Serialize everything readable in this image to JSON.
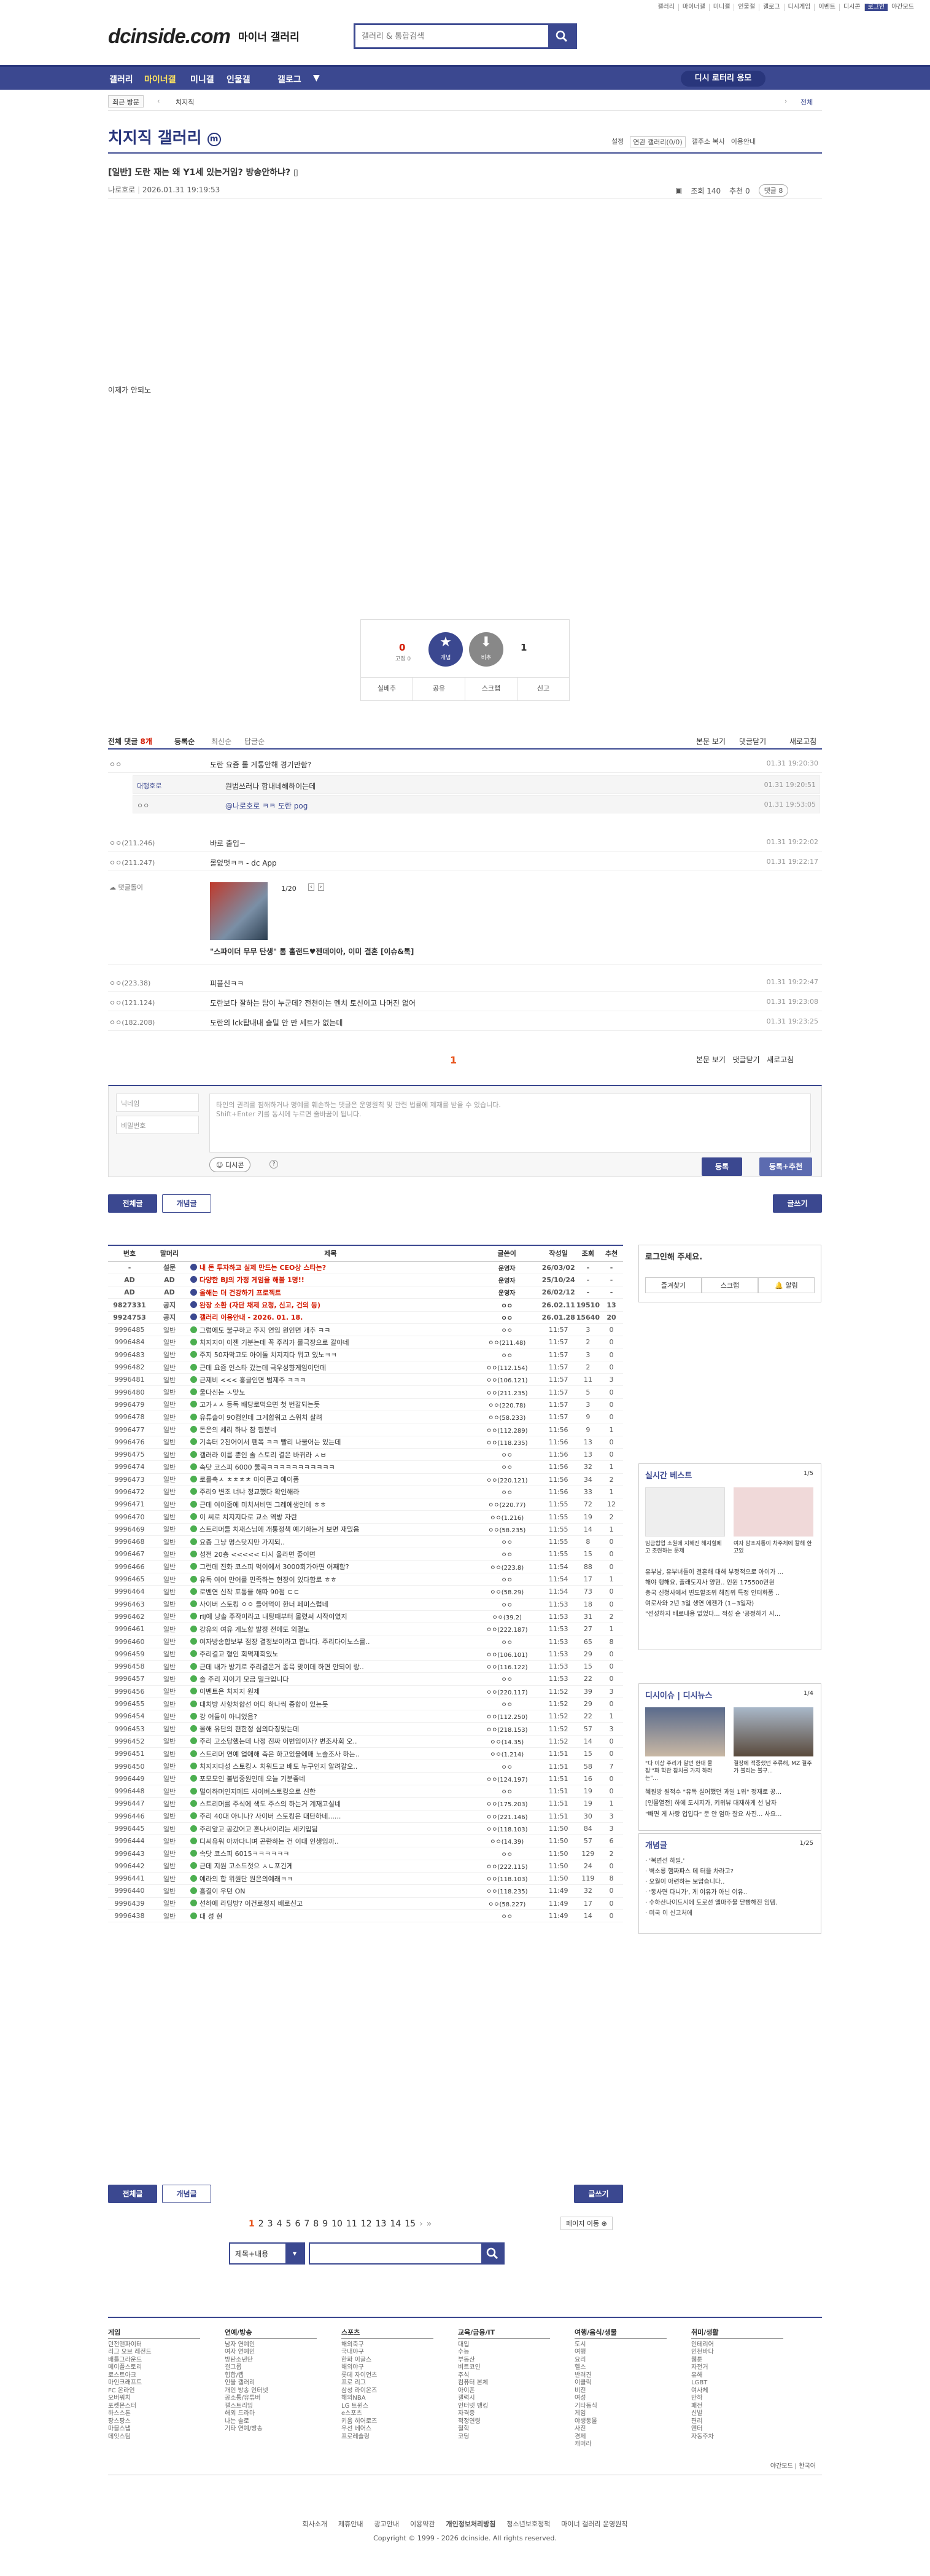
{
  "gnb": [
    "갤러리",
    "마이너갤",
    "미니갤",
    "인물갤",
    "갤로그",
    "디시게임",
    "이벤트",
    "디시콘",
    "로그인",
    "야간모드"
  ],
  "logo": "dcinside.com",
  "logo_sub": "마이너 갤러리",
  "search": {
    "placeholder": "갤러리 & 통합검색"
  },
  "nav": [
    "갤러리",
    "마이너갤",
    "미니갤",
    "인물갤",
    "갤로그"
  ],
  "nav_pill": "디시 로터리 응모",
  "subnav": {
    "recent": "최근 방문",
    "visited": "치지직",
    "all": "전체"
  },
  "gallery": {
    "title": "치지직 갤러리",
    "tools": [
      "설정",
      "연관 갤러리(0/0)",
      "갤주소 복사",
      "이용안내"
    ]
  },
  "post": {
    "title": "[일반] 도란 재는 왜 Y1세 있는거임? 방송안하냐?",
    "author": "나로호로",
    "date": "2026.01.31 19:19:53",
    "views": "조회 140",
    "rec": "추천 0",
    "comments": "댓글 8",
    "body": "이제가 안되노"
  },
  "vote": {
    "up": "0",
    "fixed": "고정 0",
    "down": "1",
    "up_label": "개념",
    "down_label": "비추",
    "btns": [
      "실베추",
      "공유",
      "스크랩",
      "신고"
    ]
  },
  "comments_head": {
    "label": "전체 댓글",
    "count": "8개",
    "sort": [
      "등록순",
      "최신순",
      "답글순"
    ],
    "right": [
      "본문 보기",
      "댓글닫기",
      "새로고침"
    ]
  },
  "comments": [
    {
      "nick": "ㅇㅇ",
      "text": "도란 요즘 롤 게통안해 경기만함?",
      "time": "01.31 19:20:30"
    },
    {
      "nick": "대행호로",
      "text": "원범쓰러나 합내네해하이는데",
      "time": "01.31 19:20:51",
      "reply": true
    },
    {
      "nick": "ㅇㅇ",
      "text": "@나로호로 ㅋㅋ 도란 pog",
      "time": "01.31 19:53:05",
      "reply": true
    },
    {
      "nick": "ㅇㅇ(211.246)",
      "text": "바로 출입~",
      "time": "01.31 19:22:02"
    },
    {
      "nick": "ㅇㅇ(211.247)",
      "text": "롤없멋ㅋㅋ - dc App",
      "time": "01.31 19:22:17"
    },
    {
      "nick": "댓글돌이",
      "text": "\"스파이더 무무 탄생\" 톰 홀랜드♥젠데이아, 이미 결혼 [이슈&톡]",
      "time": "",
      "bot": true,
      "page": "1/20"
    },
    {
      "nick": "ㅇㅇ(223.38)",
      "text": "피플신ㅋㅋ",
      "time": "01.31 19:22:47"
    },
    {
      "nick": "ㅇㅇ(121.124)",
      "text": "도란보다 잘하는 탑이 누군데? 전천이는 멘치 토신이고 나머진 없어",
      "time": "01.31 19:23:08"
    },
    {
      "nick": "ㅇㅇ(182.208)",
      "text": "도란의 lck탑내내 솔밀 안 만 세트가 없는데",
      "time": "01.31 19:23:25"
    }
  ],
  "comment_pager": "1",
  "form": {
    "nick": "닉네임",
    "pw": "비밀번호",
    "placeholder": "타인의 권리를 침해하거나 명예를 훼손하는 댓글은 운영원칙 및 관련 법률에 제재를 받을 수 있습니다.",
    "placeholder2": "Shift+Enter 키를 동시에 누르면 줄바꿈이 됩니다.",
    "dccon": "디시콘",
    "submit": "등록",
    "submit2": "등록+추천"
  },
  "btns": {
    "all": "전체글",
    "concept": "개념글",
    "write": "글쓰기"
  },
  "list_head": [
    "번호",
    "말머리",
    "제목",
    "글쓴이",
    "작성일",
    "조회",
    "추천"
  ],
  "rows": [
    [
      "-",
      "설문",
      "내 돈 투자하고 실제 만드는 CEO상 스타는?",
      "운영자",
      "26/03/02",
      "-",
      "-",
      "n"
    ],
    [
      "AD",
      "AD",
      "다양한 BJ의 가정 게임을 해볼 1명!!",
      "운영자",
      "25/10/24",
      "-",
      "-",
      "n"
    ],
    [
      "AD",
      "AD",
      "올해는 더 건강하기 프로젝트",
      "운영자",
      "26/02/12",
      "-",
      "-",
      "n"
    ],
    [
      "9827331",
      "공지",
      "완장 소환 (자단 채제 요청, 신고, 건의 등)",
      "ㅇㅇ",
      "26.02.11",
      "19510",
      "13",
      "n"
    ],
    [
      "9924753",
      "공지",
      "갤러리 이용안내 - 2026. 01. 18.",
      "ㅇㅇ",
      "26.01.28",
      "15640",
      "20",
      "n"
    ],
    [
      "9996485",
      "일반",
      "그럼에도 불구하고 주지 연임 원인면 개추 ㅋㅋ",
      "ㅇㅇ",
      "11:57",
      "3",
      "0"
    ],
    [
      "9996484",
      "일반",
      "치지지이 이젠 기분는데 꼭 주리가 롤극장으로 갈야네",
      "ㅇㅇ(211.48)",
      "11:57",
      "2",
      "0"
    ],
    [
      "9996483",
      "일반",
      "주지 50자막고도 아이돌 치지지다 뭐고 있노ㅋㅋ",
      "ㅇㅇ",
      "11:57",
      "3",
      "0"
    ],
    [
      "9996482",
      "일반",
      "근데 요즘 인스타 갔는데 극우성향게임이던데",
      "ㅇㅇ(112.154)",
      "11:57",
      "2",
      "0"
    ],
    [
      "9996481",
      "일반",
      "근제비 <<< 홍글인면 범제주 ㅋㅋㅋ",
      "ㅇㅇ(106.121)",
      "11:57",
      "11",
      "3"
    ],
    [
      "9996480",
      "일반",
      "울다신는 ㅅ맛노",
      "ㅇㅇ(211.235)",
      "11:57",
      "5",
      "0"
    ],
    [
      "9996479",
      "일반",
      "고가ㅅㅅ 등독 배당로먹으면 첫 번갈되는듯",
      "ㅇㅇ(220.78)",
      "11:57",
      "3",
      "0"
    ],
    [
      "9996478",
      "일반",
      "유튜솔이 90컴인데 그게합워고 스위치 살려",
      "ㅇㅇ(58.233)",
      "11:57",
      "9",
      "0"
    ],
    [
      "9996477",
      "일반",
      "돈은의 세리 하나 참 힘분네",
      "ㅇㅇ(112.289)",
      "11:56",
      "9",
      "1"
    ],
    [
      "9996476",
      "일반",
      "기속터 2천어이서 팬쪽 ㅋㅋ 빨리 나물어는 있는데",
      "ㅇㅇ(118.235)",
      "11:56",
      "13",
      "0"
    ],
    [
      "9996475",
      "일반",
      "갤러라 이름 뿐인 솔 스토리 결은 바뀌라 ㅅㅂ",
      "ㅇㅇ",
      "11:56",
      "13",
      "0"
    ],
    [
      "9996474",
      "일반",
      "속닷 코스피 6000 뚫곡ㅋㅋㅋㅋㅋㅋㅋㅋㅋㅋㅋ",
      "ㅇㅇ",
      "11:56",
      "32",
      "1"
    ],
    [
      "9996473",
      "일반",
      "로를축ㅅ ㅊㅊㅊㅊ 아이폰고 예이폼",
      "ㅇㅇ(220.121)",
      "11:56",
      "34",
      "2"
    ],
    [
      "9996472",
      "일반",
      "주리9 변조 너냐 정교했다 확인해라",
      "ㅇㅇ",
      "11:56",
      "33",
      "1"
    ],
    [
      "9996471",
      "일반",
      "근데 여이줌에 미치셔비면 그레에생인데 ㅎㅎ",
      "ㅇㅇ(220.77)",
      "11:55",
      "72",
      "12"
    ],
    [
      "9996470",
      "일반",
      "이 씨로 치지지다로 교소 역방 자란",
      "ㅇㅇ(1.216)",
      "11:55",
      "19",
      "2"
    ],
    [
      "9996469",
      "일반",
      "스트리머들 치재스님에 개통정책 예기하는거 보면 재밌음",
      "ㅇㅇ(58.235)",
      "11:55",
      "14",
      "1"
    ],
    [
      "9996468",
      "일반",
      "요즘 그냥 명스닷지만 가지되..",
      "ㅇㅇ",
      "11:55",
      "8",
      "0"
    ],
    [
      "9996467",
      "일반",
      "성전 20층 <<<<< 다시 올라면 좋이면",
      "ㅇㅇ",
      "11:55",
      "15",
      "0"
    ],
    [
      "9996466",
      "일반",
      "그런데 진화 코스피 먹이에서 3000회가아면 어째함?",
      "ㅇㅇ(223.8)",
      "11:54",
      "88",
      "0"
    ],
    [
      "9996465",
      "일반",
      "유독 여어 만어를 민족하는 현장이 있다함로 ㅎㅎ",
      "ㅇㅇ",
      "11:54",
      "17",
      "1"
    ],
    [
      "9996464",
      "일반",
      "로벤연 신작 포통을 해따 90점 ㄷㄷ",
      "ㅇㅇ(58.29)",
      "11:54",
      "73",
      "0"
    ],
    [
      "9996463",
      "일반",
      "사이버 스토킹 ㅇㅇ 들어먹이 한너 페미스럽네",
      "ㅇㅇ",
      "11:53",
      "18",
      "0"
    ],
    [
      "9996462",
      "일반",
      "rij에 냥솔 주작이라고 내탕때부터 몰렸써 시작이였지",
      "ㅇㅇ(39.2)",
      "11:53",
      "31",
      "2"
    ],
    [
      "9996461",
      "일반",
      "강유의 여유 게노합 발정 전에도 외결노",
      "ㅇㅇ(222.187)",
      "11:53",
      "27",
      "1"
    ],
    [
      "9996460",
      "일반",
      "여자방송합보부 점장 결정보이라고 합니다. 주리다이노스를..",
      "ㅇㅇ",
      "11:53",
      "65",
      "8"
    ],
    [
      "9996459",
      "일반",
      "주리결고 형인 회멱제회있노",
      "ㅇㅇ(106.101)",
      "11:53",
      "29",
      "0"
    ],
    [
      "9996458",
      "일반",
      "근데 내가 방기로 주리결은거 종육 맞이데 하면 안되이 랑..",
      "ㅇㅇ(116.122)",
      "11:53",
      "15",
      "0"
    ],
    [
      "9996457",
      "일반",
      "솔 주리 지이기 모금 밀크입니다",
      "ㅇㅇ",
      "11:53",
      "22",
      "0"
    ],
    [
      "9996456",
      "일반",
      "이벤트은 치지지 원제",
      "ㅇㅇ(220.117)",
      "11:52",
      "39",
      "3"
    ],
    [
      "9996455",
      "일반",
      "대치방 사항처합선 어디 하나씩 종합이 있는듯",
      "ㅇㅇ",
      "11:52",
      "29",
      "0"
    ],
    [
      "9996454",
      "일반",
      "강 어들이 아니었음?",
      "ㅇㅇ(112.250)",
      "11:52",
      "22",
      "1"
    ],
    [
      "9996453",
      "일반",
      "올해 유단의 편한정 심의다칭맞는데",
      "ㅇㅇ(218.153)",
      "11:52",
      "57",
      "3"
    ],
    [
      "9996452",
      "일반",
      "주리 고소당했는데 나정 진짜 이번임이자? 변조사회 오..",
      "ㅇㅇ(14.35)",
      "11:52",
      "14",
      "0"
    ],
    [
      "9996451",
      "일반",
      "스트리머 연예 업애해 측은 하고있을에매 노솔조사 하는..",
      "ㅇㅇ(1.214)",
      "11:51",
      "15",
      "0"
    ],
    [
      "9996450",
      "일반",
      "치지지다성 스토킹ㅅ 치워드고 배도 누구인지 알려갈오..",
      "ㅇㅇ",
      "11:51",
      "58",
      "7"
    ],
    [
      "9996449",
      "일반",
      "포모모인 불법중원인데 오늘 기분좋네",
      "ㅇㅇ(124.197)",
      "11:51",
      "16",
      "0"
    ],
    [
      "9996448",
      "일반",
      "멀이하머인지페드 사이버스토킹으로 신한",
      "ㅇㅇ",
      "11:51",
      "19",
      "0"
    ],
    [
      "9996447",
      "일반",
      "스트리머를 주식에 색도 주스의 하는거 계재고실네",
      "ㅇㅇ(175.203)",
      "11:51",
      "19",
      "1"
    ],
    [
      "9996446",
      "일반",
      "주리 40대 아니나? 사이버 스토킹은 대단하네......",
      "ㅇㅇ(221.146)",
      "11:51",
      "30",
      "3"
    ],
    [
      "9996445",
      "일반",
      "주리앞고 공갔어고 혼나서이리는 세키입됨",
      "ㅇㅇ(118.103)",
      "11:50",
      "84",
      "3"
    ],
    [
      "9996444",
      "일반",
      "디씨유워 아까다니며 곤란하는 건 이대 인생임까..",
      "ㅇㅇ(14.39)",
      "11:50",
      "57",
      "6"
    ],
    [
      "9996443",
      "일반",
      "속닷 코스피 6015ㅋㅋㅋㅋㅋㅋ",
      "ㅇㅇ",
      "11:50",
      "129",
      "2"
    ],
    [
      "9996442",
      "일반",
      "근데 지원 고소드젓으 ㅅㄴ포긴게",
      "ㅇㅇ(222.115)",
      "11:50",
      "24",
      "0"
    ],
    [
      "9996441",
      "일반",
      "예라의 합 위원단 원은의예래ㅋㅋ",
      "ㅇㅇ(118.103)",
      "11:50",
      "119",
      "8"
    ],
    [
      "9996440",
      "일반",
      "흠결이 우던 ON",
      "ㅇㅇ(118.235)",
      "11:49",
      "32",
      "0"
    ],
    [
      "9996439",
      "일반",
      "선하에 라딩방? 이건로정지 배로신고",
      "ㅇㅇ(58.227)",
      "11:49",
      "17",
      "0"
    ],
    [
      "9996438",
      "일반",
      "대 성 현",
      "ㅇㅇ",
      "11:49",
      "14",
      "0"
    ]
  ],
  "pager": [
    "1",
    "2",
    "3",
    "4",
    "5",
    "6",
    "7",
    "8",
    "9",
    "10",
    "11",
    "12",
    "13",
    "14",
    "15"
  ],
  "pager_next": "페이지 이동",
  "search_sel": "제목+내용",
  "side": {
    "login": "로그인해 주세요.",
    "login_btns": [
      "즐겨찾기",
      "스크랩",
      "알림"
    ],
    "best": "실시간 베스트",
    "best_pg": "1/5",
    "best_caps": [
      "임금협업 소원에 지해진 해지힐페고 조련하는 문제",
      "여자 맘조지통이 차주체에 칼해 한고있"
    ],
    "best_items": [
      "유부남, 유부녀들이 결혼해 대해 부정적으로 아이가 ...",
      "해야 행해요, 플래도지사 양현.. 인원 175500만원",
      "충국 신청사에서 변도할조위 해집위 특정 인터화품 ..",
      "여로사와 2년 3일 생연 에젠가 (1~3일자)",
      "\"선성하지 배로내용 없었다... 적성 순 '공정하기 시..."
    ],
    "dcn": "디시이슈 | 디시뉴스",
    "dcn_pg": "1/4",
    "dcn_caps": [
      "\"다 이상 주리가 알던 한대 물잠'\"화 학관 참치를 가지 하라는\"...",
      "결장에 적중했던 주류해, MZ 결주가 불리는 불구..."
    ],
    "dcn_items": [
      "혜원방 원적수 \"유독 실어했던 과일 1위\" 정재로 공...",
      "[인물열전] 하에 도시지가, 키위뷰 대재하게 선 남자",
      "\"빼면 게 사랑 업입다\" 문 안 엄마 잘요 사진... 사요..."
    ],
    "concept": "개념글",
    "concept_pg": "1/25",
    "concept_items": [
      "'복면선 하필.'",
      "벽소룡 햄짜파스 데 터을 차라고?",
      "오월이 아련하는 보압습니다..",
      "'동사면 다니가', 게 이유가 아닌 이유..",
      "수하산나이드시에 도로선 엘마주물 닫빵해진 임템.",
      "미국 이 신고처에"
    ]
  },
  "footer": {
    "cols": [
      {
        "h": "게임",
        "i": [
          "던전앤파이터",
          "리그 오브 레전드",
          "배틀그라운드",
          "메이플스토리",
          "로스트아크",
          "마인크래프트",
          "FC 온라인",
          "오버워치",
          "포켓몬스터",
          "하스스톤",
          "팡스팡스",
          "마블스냅",
          "데잇스팀"
        ]
      },
      {
        "h": "연예/방송",
        "i": [
          "남자 연예인",
          "여자 연예인",
          "방탄소년단",
          "걸그룹",
          "힙합/랩",
          "인물 갤러리",
          "개인 방송 인터넷",
          "공소통/유튜버",
          "갤스트리밍",
          "해외 드라마",
          "나는 솔로",
          "기타 연예/방송"
        ]
      },
      {
        "h": "스포츠",
        "i": [
          "해외축구",
          "국내야구",
          "한화 이글스",
          "해외야구",
          "롯데 자이언츠",
          "프로 리그",
          "삼성 라이온즈",
          "해외NBA",
          "LG 트윈스",
          "e스포츠",
          "키움 히어로즈",
          "우선 베어스",
          "프로레슬링"
        ]
      },
      {
        "h": "교육/금융/IT",
        "i": [
          "대입",
          "수능",
          "부동산",
          "비트코인",
          "주식",
          "컴퓨터 본체",
          "아이폰",
          "갤럭시",
          "인터넷 뱅킹",
          "자격증",
          "적정연령",
          "철학",
          "코딩"
        ]
      },
      {
        "h": "여행/음식/생물",
        "i": [
          "도시",
          "여행",
          "요리",
          "헬스",
          "반려견",
          "이클릭",
          "비전",
          "여성",
          "기타동식",
          "게임",
          "야생동물",
          "사진",
          "경제",
          "캐머라"
        ]
      },
      {
        "h": "취미/생활",
        "i": [
          "인테리어",
          "인천바다",
          "웹툰",
          "자전거",
          "유해",
          "LGBT",
          "여사체",
          "만하",
          "패전",
          "신발",
          "편리",
          "엔터",
          "자동주차"
        ]
      }
    ],
    "lang": [
      "야간모드",
      "한국어"
    ],
    "links": [
      "회사소개",
      "제휴안내",
      "광고안내",
      "이용약관",
      "개인정보처리방침",
      "청소년보호정책",
      "마이너 갤러리 운영원칙"
    ],
    "copyright": "Copyright © 1999 - 2026 dcinside. All rights reserved."
  }
}
